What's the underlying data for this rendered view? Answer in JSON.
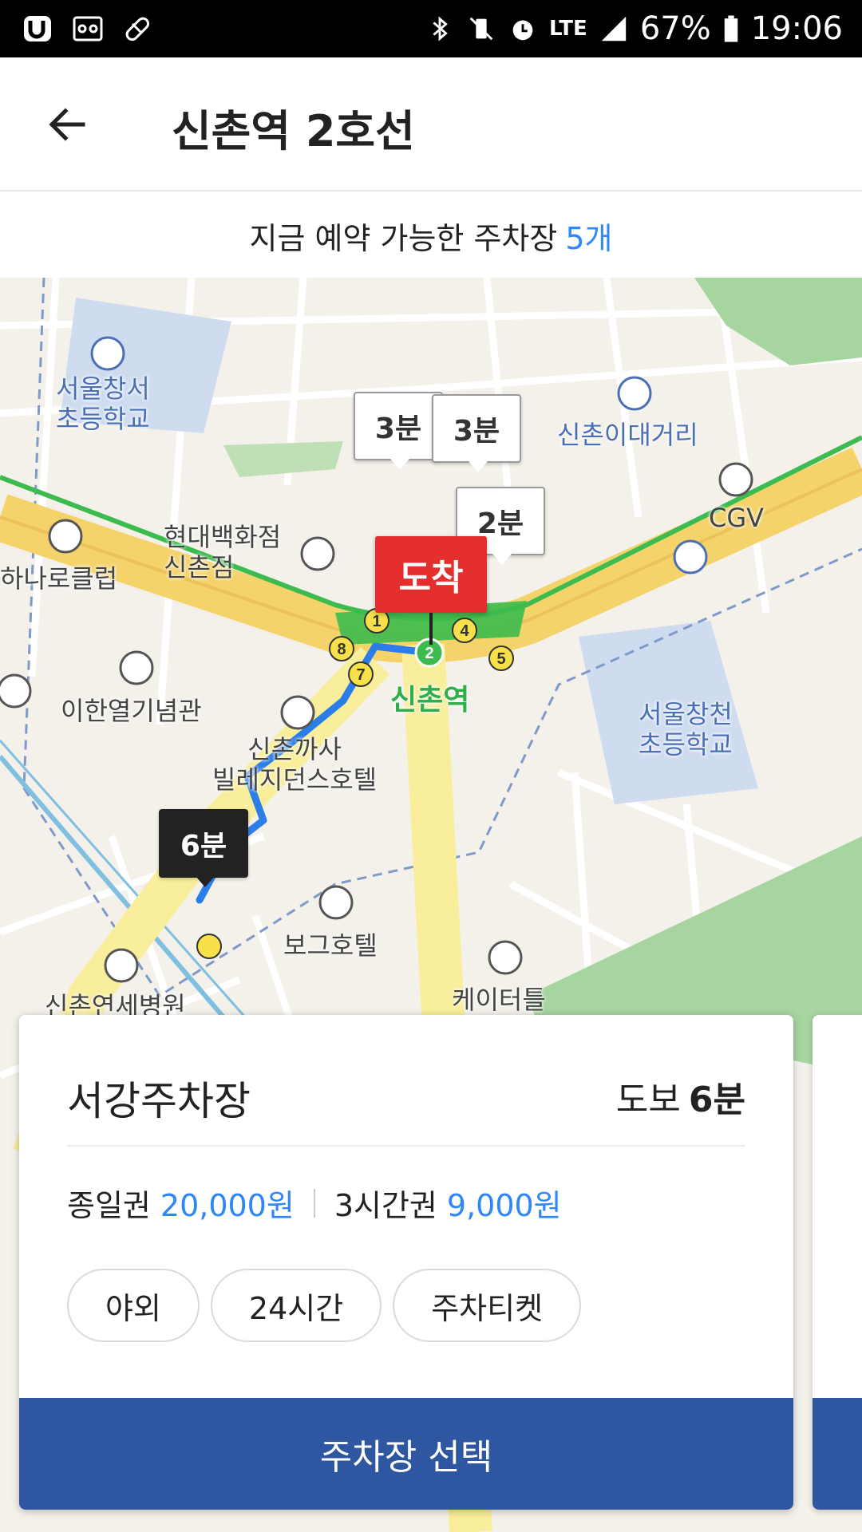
{
  "status_bar": {
    "battery_text": "67%",
    "network": "LTE",
    "time": "19:06",
    "icons": [
      "app-u-icon",
      "cassette-icon",
      "pill-icon",
      "bluetooth-icon",
      "vibrate-icon",
      "alarm-icon",
      "lte-icon",
      "signal-icon",
      "battery-icon"
    ]
  },
  "header": {
    "back_icon": "back-arrow-icon",
    "title": "신촌역 2호선"
  },
  "availability": {
    "text": "지금 예약 가능한 주차장",
    "count": "5개"
  },
  "map": {
    "labels": {
      "school1": "서울창서\n초등학교",
      "intersection": "신촌이대거리",
      "dept_store": "현대백화점\n신촌점",
      "club": "하나로클럽",
      "cgv": "CGV",
      "memorial": "이한열기념관",
      "station": "신촌역",
      "hotel1": "신촌까사\n빌레지던스호텔",
      "school2": "서울창천\n초등학교",
      "hotel2": "보그호텔",
      "catering": "케이터틀",
      "hospital": "신촌연세병원"
    },
    "time_markers": [
      "3분",
      "3분",
      "2분",
      "6분"
    ],
    "arrival_label": "도착",
    "exit_numbers": [
      "1",
      "4",
      "5",
      "7",
      "8",
      "2"
    ],
    "colors": {
      "road_major": "#f4d36b",
      "subway": "#3dbb4e",
      "route": "#2b7de9",
      "arrival": "#e52e2e"
    }
  },
  "card": {
    "name": "서강주차장",
    "walk_label": "도보",
    "walk_time": "6분",
    "price_day_label": "종일권",
    "price_day_value": "20,000원",
    "price_3h_label": "3시간권",
    "price_3h_value": "9,000원",
    "tags": [
      "야외",
      "24시간",
      "주차티켓"
    ],
    "select_label": "주차장 선택",
    "accent_color": "#2f56a0"
  }
}
